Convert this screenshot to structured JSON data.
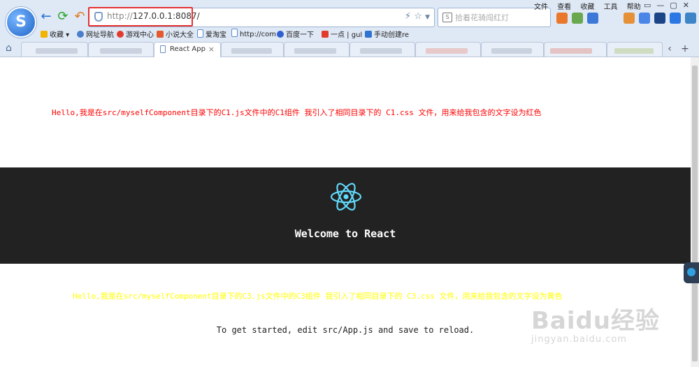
{
  "browser": {
    "url_scheme": "http://",
    "url_host": "127.0.0.1:8087/",
    "search_placeholder": "拾着花骑闯红灯",
    "menus": [
      "文件",
      "查看",
      "收藏",
      "工具",
      "帮助"
    ],
    "window_controls": [
      "▭",
      "—",
      "▢",
      "✕"
    ],
    "bookmarks": [
      {
        "label": "收藏",
        "color": "#f2b400"
      },
      {
        "label": "网址导航",
        "color": "#4a7fc9"
      },
      {
        "label": "游戏中心",
        "color": "#e23b2e"
      },
      {
        "label": "小说大全",
        "color": "#e25a2e"
      },
      {
        "label": "爱淘宝",
        "color": "#5b8bd0"
      },
      {
        "label": "http://com",
        "color": "#5b8bd0"
      },
      {
        "label": "百度一下",
        "color": "#3060d0"
      },
      {
        "label": "一点 | gul",
        "color": "#e23b2e"
      },
      {
        "label": "手动创建re",
        "color": "#2f74d0"
      }
    ],
    "active_tab_label": "React App",
    "tab_close_glyph": "×",
    "new_tab_glyph": "+"
  },
  "page": {
    "c1_text": "Hello,我是在src/myselfComponent目录下的C1.js文件中的C1组件 我引入了相同目录下的 C1.css 文件，用来给我包含的文字设为红色",
    "header_title": "Welcome to React",
    "c3_text": "Hello,我是在src/myselfComponent目录下的C3.js文件中的C3组件 我引入了相同目录下的 C3.css 文件，用来给我包含的文字设为黄色",
    "intro_text": "To get started, edit src/App.js and save to reload."
  },
  "watermark": {
    "brand": "Baidu经验",
    "url": "jingyan.baidu.com"
  },
  "colors": {
    "c1_text": "#ff0000",
    "c3_text": "#ffff00",
    "header_bg": "#222222",
    "react_logo": "#61dafb",
    "url_highlight": "#e43131"
  }
}
